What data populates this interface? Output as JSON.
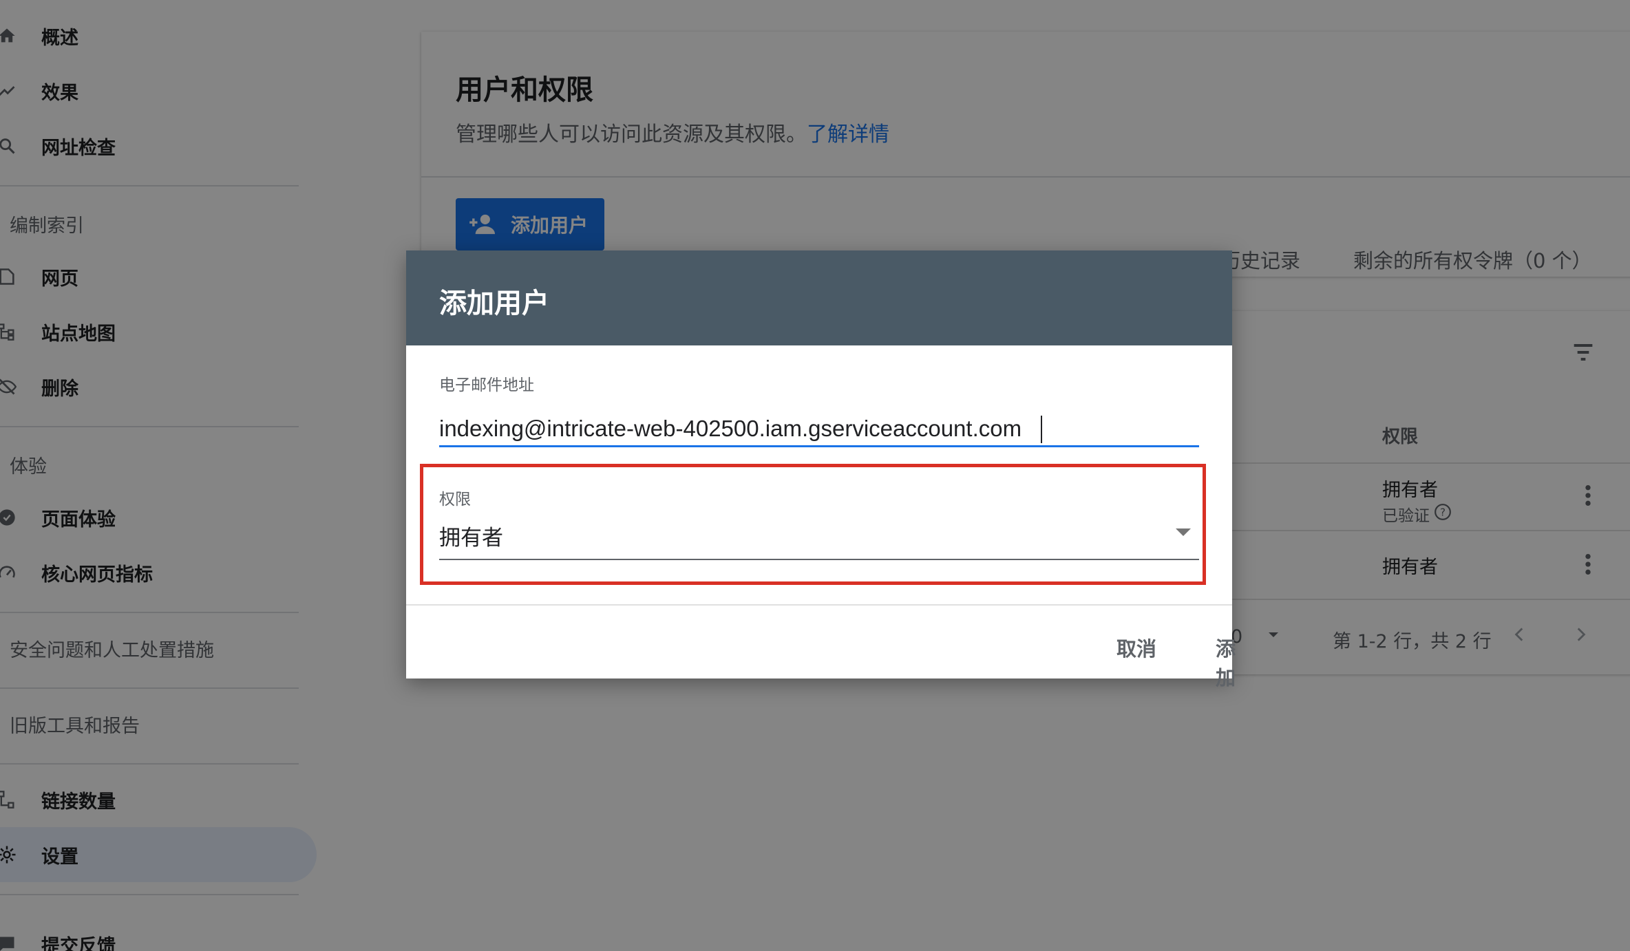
{
  "sidebar": {
    "items": [
      {
        "label": "概述",
        "icon": "home-icon"
      },
      {
        "label": "效果",
        "icon": "trending-icon"
      },
      {
        "label": "网址检查",
        "icon": "search-icon"
      },
      {
        "label": "网页",
        "icon": "page-icon"
      },
      {
        "label": "站点地图",
        "icon": "sitemap-icon"
      },
      {
        "label": "删除",
        "icon": "visibility-off-icon"
      },
      {
        "label": "页面体验",
        "icon": "experience-icon"
      },
      {
        "label": "核心网页指标",
        "icon": "speed-icon"
      },
      {
        "label": "链接数量",
        "icon": "links-icon"
      },
      {
        "label": "设置",
        "icon": "gear-icon"
      },
      {
        "label": "提交反馈",
        "icon": "feedback-icon"
      }
    ],
    "sections": {
      "index": "编制索引",
      "experience": "体验",
      "security": "安全问题和人工处置措施",
      "legacy": "旧版工具和报告"
    },
    "active_color": "#e8f0fe"
  },
  "main": {
    "title": "用户和权限",
    "subtitle": "管理哪些人可以访问此资源及其权限。",
    "learn_more": "了解详情",
    "add_user_button": "添加用户",
    "ownership_history": "所有权历史记录",
    "ownership_tokens": "剩余的所有权令牌（0 个）",
    "table": {
      "permission_header": "权限",
      "rows": [
        {
          "role": "拥有者",
          "status": "已验证"
        },
        {
          "role": "拥有者"
        }
      ],
      "rows_per_page_value": "0",
      "range_text": "第 1-2 行，共 2 行"
    }
  },
  "dialog": {
    "title": "添加用户",
    "email_label": "电子邮件地址",
    "email_value": "indexing@intricate-web-402500.iam.gserviceaccount.com",
    "permission_label": "权限",
    "permission_value": "拥有者",
    "cancel_label": "取消",
    "add_label": "添加"
  },
  "colors": {
    "accent": "#1a73e8",
    "dialog_header": "#4a5a66",
    "highlight": "#d93025"
  }
}
